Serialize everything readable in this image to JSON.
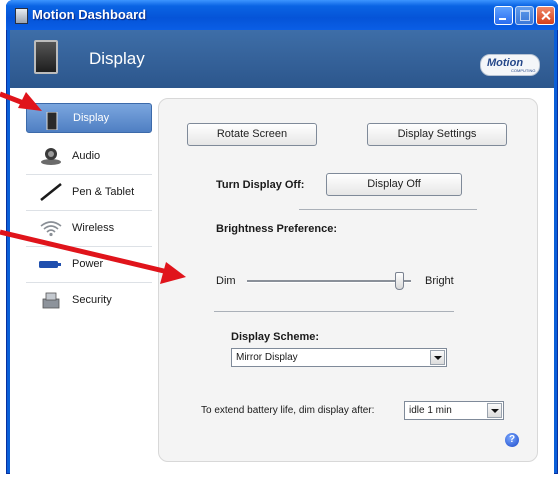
{
  "window": {
    "title": "Motion Dashboard"
  },
  "header": {
    "title": "Display",
    "logo_text": "Motion",
    "logo_subtext": "COMPUTING"
  },
  "sidebar": {
    "items": [
      {
        "label": "Display",
        "icon": "display-icon",
        "selected": true
      },
      {
        "label": "Audio",
        "icon": "audio-icon",
        "selected": false
      },
      {
        "label": "Pen & Tablet",
        "icon": "pen-icon",
        "selected": false
      },
      {
        "label": "Wireless",
        "icon": "wireless-icon",
        "selected": false
      },
      {
        "label": "Power",
        "icon": "power-icon",
        "selected": false
      },
      {
        "label": "Security",
        "icon": "security-icon",
        "selected": false
      }
    ]
  },
  "panel": {
    "rotate_button": "Rotate Screen",
    "settings_button": "Display Settings",
    "turn_off_label": "Turn Display Off:",
    "display_off_button": "Display Off",
    "brightness_label": "Brightness Preference:",
    "slider": {
      "min_label": "Dim",
      "max_label": "Bright",
      "value": 0.9
    },
    "scheme_label": "Display Scheme:",
    "scheme_value": "Mirror Display",
    "battery_label": "To extend battery life, dim display after:",
    "battery_value": "idle 1 min",
    "help_symbol": "?"
  },
  "colors": {
    "annotation_arrow": "#e0141b",
    "title_bar": "#0a5fd8",
    "header_band": "#2c568c"
  }
}
